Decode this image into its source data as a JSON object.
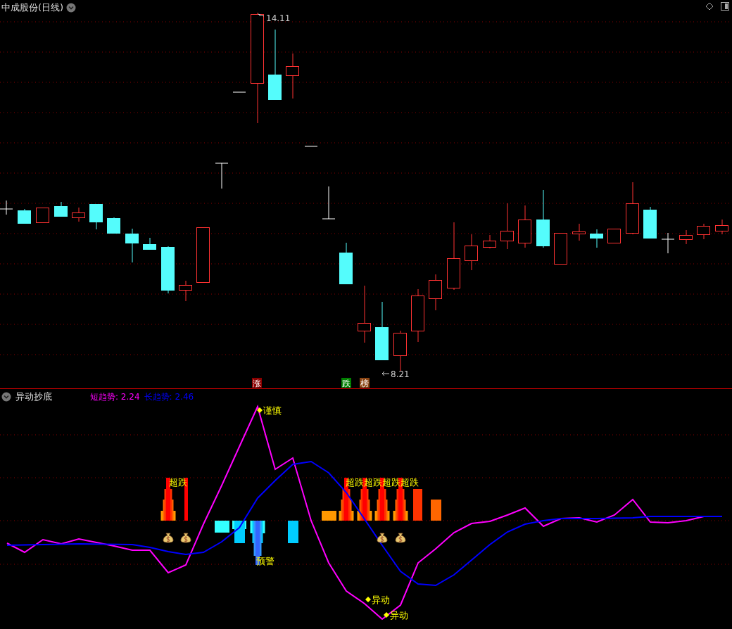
{
  "price_pane": {
    "title": "中成股份(日线)",
    "high_label": "14.11",
    "low_label": "8.21",
    "markers": [
      {
        "text": "涨",
        "color": "#8b0000"
      },
      {
        "text": "跌",
        "color": "#008000"
      },
      {
        "text": "榜",
        "color": "#8b4513"
      }
    ]
  },
  "indicator_pane": {
    "title": "异动抄底",
    "legend": [
      {
        "text": "短趋势: 2.24",
        "color": "#ff00ff"
      },
      {
        "text": "长趋势: 2.46",
        "color": "#0000ff"
      }
    ],
    "annotations": [
      {
        "kind": "diamond",
        "text": "谨慎"
      },
      {
        "kind": "plain",
        "text": "超跌"
      },
      {
        "kind": "plain",
        "text": "超跌"
      },
      {
        "kind": "plain",
        "text": "超跌"
      },
      {
        "kind": "plain",
        "text": "超跌"
      },
      {
        "kind": "plain",
        "text": "超跌"
      },
      {
        "kind": "plain",
        "text": "预警"
      },
      {
        "kind": "diamond",
        "text": "异动"
      },
      {
        "kind": "diamond",
        "text": "异动"
      }
    ]
  }
}
